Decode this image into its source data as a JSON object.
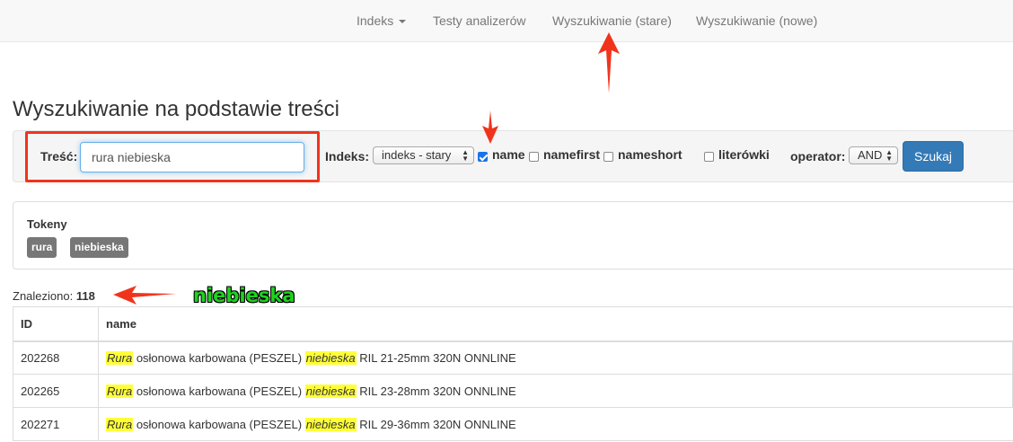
{
  "nav": {
    "items": [
      {
        "label": "Indeks",
        "dropdown": true
      },
      {
        "label": "Testy analizerów"
      },
      {
        "label": "Wyszukiwanie (stare)"
      },
      {
        "label": "Wyszukiwanie (nowe)"
      }
    ]
  },
  "page": {
    "title": "Wyszukiwanie na podstawie treści"
  },
  "search": {
    "content_label": "Treść:",
    "content_value": "rura niebieska",
    "index_label": "Indeks:",
    "index_selected": "indeks - stary",
    "fields": [
      {
        "label": "name",
        "checked": true
      },
      {
        "label": "namefirst",
        "checked": false
      },
      {
        "label": "nameshort",
        "checked": false
      },
      {
        "label": "literówki",
        "checked": false
      }
    ],
    "operator_label": "operator:",
    "operator_selected": "AND",
    "submit_label": "Szukaj"
  },
  "tokens": {
    "title": "Tokeny",
    "items": [
      "rura",
      "niebieska"
    ]
  },
  "results": {
    "found_label": "Znaleziono:",
    "found_count": "118",
    "columns": [
      "ID",
      "name"
    ],
    "rows": [
      {
        "id": "202268",
        "hl1": "Rura",
        "mid": "osłonowa karbowana (PESZEL)",
        "hl2": "niebieska",
        "rest": "RIL 21-25mm 320N ONNLINE"
      },
      {
        "id": "202265",
        "hl1": "Rura",
        "mid": "osłonowa karbowana (PESZEL)",
        "hl2": "niebieska",
        "rest": "RIL 23-28mm 320N ONNLINE"
      },
      {
        "id": "202271",
        "hl1": "Rura",
        "mid": "osłonowa karbowana (PESZEL)",
        "hl2": "niebieska",
        "rest": "RIL 29-36mm 320N ONNLINE"
      }
    ]
  },
  "annotation": {
    "word": "niebieska"
  },
  "colors": {
    "annotation_red": "#f2331c",
    "annotation_green": "#1fd11f",
    "primary_button": "#337ab7",
    "highlight_yellow": "#ffff38",
    "badge_gray": "#777777"
  }
}
